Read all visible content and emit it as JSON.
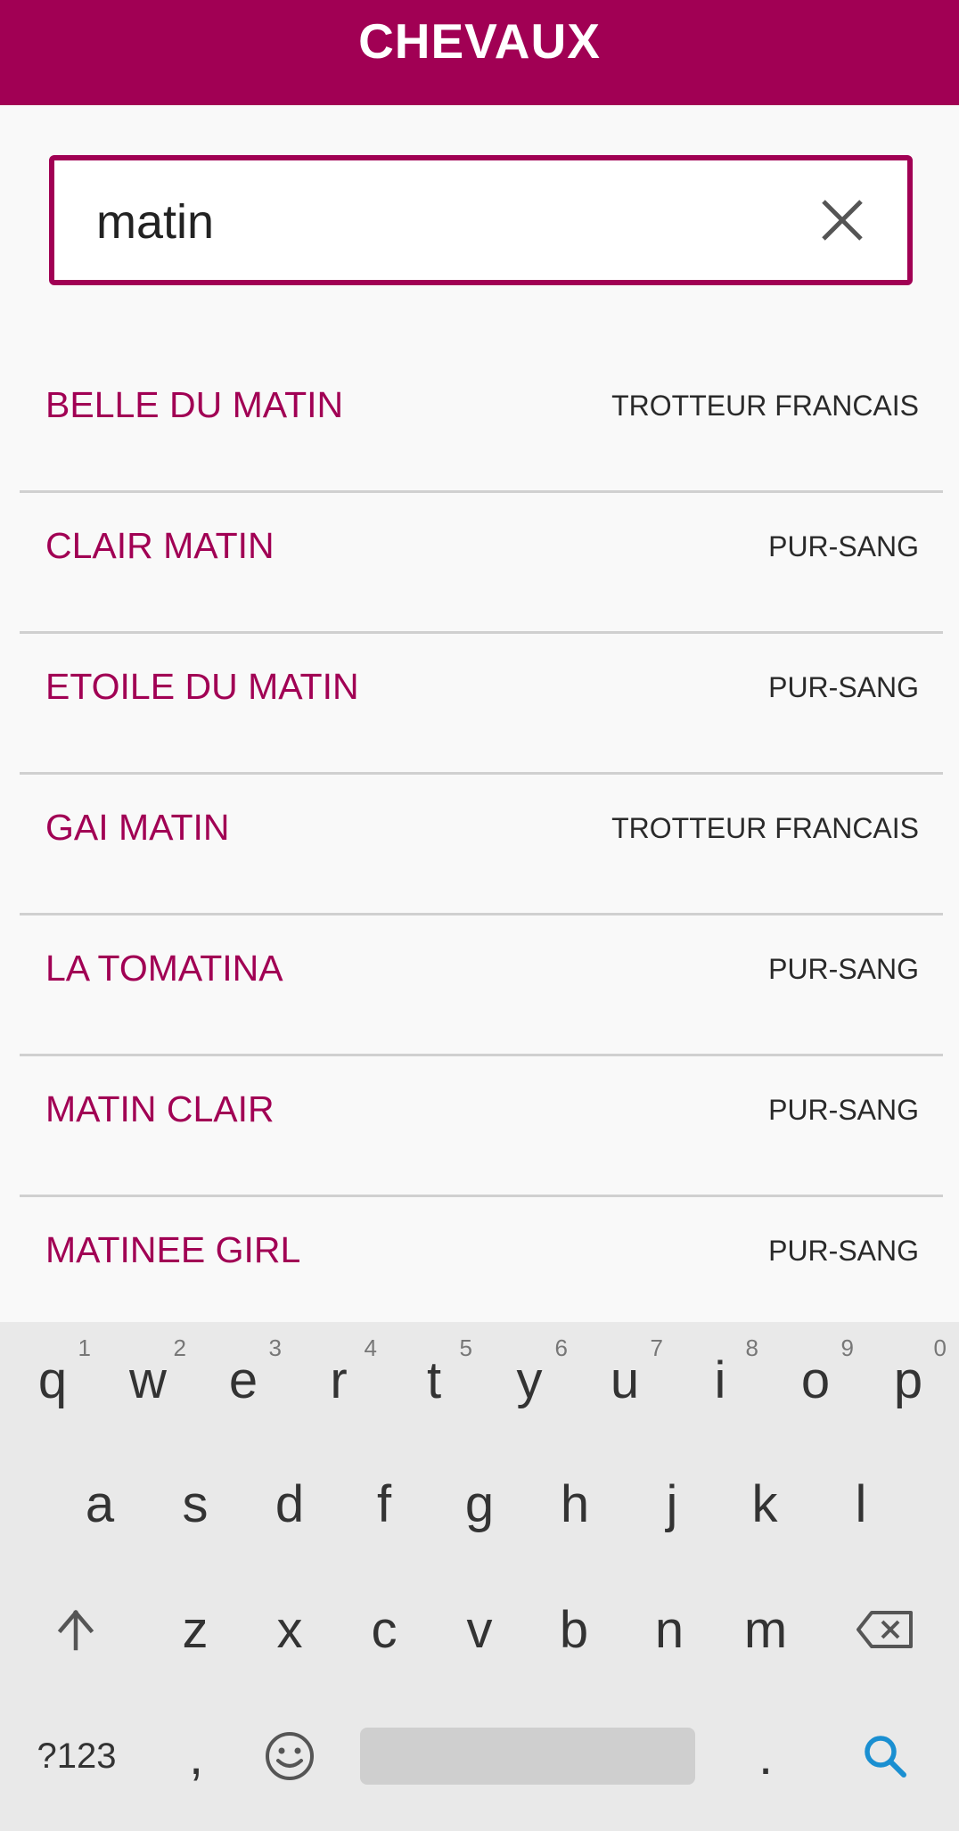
{
  "header": {
    "title": "CHEVAUX"
  },
  "search": {
    "value": "matin"
  },
  "results": [
    {
      "name": "BELLE DU MATIN",
      "breed": "TROTTEUR FRANCAIS"
    },
    {
      "name": "CLAIR MATIN",
      "breed": "PUR-SANG"
    },
    {
      "name": "ETOILE DU MATIN",
      "breed": "PUR-SANG"
    },
    {
      "name": "GAI MATIN",
      "breed": "TROTTEUR FRANCAIS"
    },
    {
      "name": "LA TOMATINA",
      "breed": "PUR-SANG"
    },
    {
      "name": "MATIN CLAIR",
      "breed": "PUR-SANG"
    },
    {
      "name": "MATINEE GIRL",
      "breed": "PUR-SANG"
    }
  ],
  "keyboard": {
    "row1": [
      {
        "key": "q",
        "hint": "1"
      },
      {
        "key": "w",
        "hint": "2"
      },
      {
        "key": "e",
        "hint": "3"
      },
      {
        "key": "r",
        "hint": "4"
      },
      {
        "key": "t",
        "hint": "5"
      },
      {
        "key": "y",
        "hint": "6"
      },
      {
        "key": "u",
        "hint": "7"
      },
      {
        "key": "i",
        "hint": "8"
      },
      {
        "key": "o",
        "hint": "9"
      },
      {
        "key": "p",
        "hint": "0"
      }
    ],
    "row2": [
      "a",
      "s",
      "d",
      "f",
      "g",
      "h",
      "j",
      "k",
      "l"
    ],
    "row3": [
      "z",
      "x",
      "c",
      "v",
      "b",
      "n",
      "m"
    ],
    "row4": {
      "symbols": "?123",
      "comma": ",",
      "period": "."
    }
  },
  "colors": {
    "accent": "#a10054",
    "search_key": "#1a8fd1"
  }
}
